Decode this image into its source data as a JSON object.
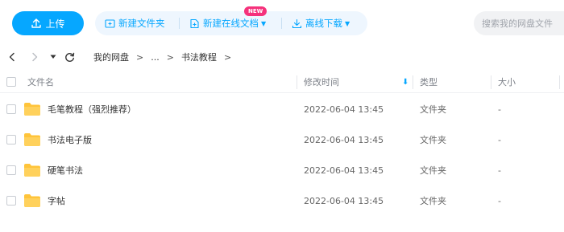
{
  "toolbar": {
    "upload_label": "上传",
    "new_folder_label": "新建文件夹",
    "new_online_doc_label": "新建在线文档",
    "new_badge": "NEW",
    "offline_download_label": "离线下载",
    "search_placeholder": "搜索我的网盘文件"
  },
  "nav": {
    "breadcrumb": [
      "我的网盘",
      "...",
      "书法教程"
    ],
    "separator": ">"
  },
  "table": {
    "columns": {
      "name": "文件名",
      "modified": "修改时间",
      "type": "类型",
      "size": "大小"
    },
    "sort_column": "modified",
    "rows": [
      {
        "name": "毛笔教程（强烈推荐）",
        "modified": "2022-06-04 13:45",
        "type": "文件夹",
        "size": "-"
      },
      {
        "name": "书法电子版",
        "modified": "2022-06-04 13:45",
        "type": "文件夹",
        "size": "-"
      },
      {
        "name": "硬笔书法",
        "modified": "2022-06-04 13:45",
        "type": "文件夹",
        "size": "-"
      },
      {
        "name": "字帖",
        "modified": "2022-06-04 13:45",
        "type": "文件夹",
        "size": "-"
      }
    ]
  },
  "colors": {
    "accent": "#06a7ff",
    "folder": "#ffc43a",
    "badge": "#f5317b"
  }
}
